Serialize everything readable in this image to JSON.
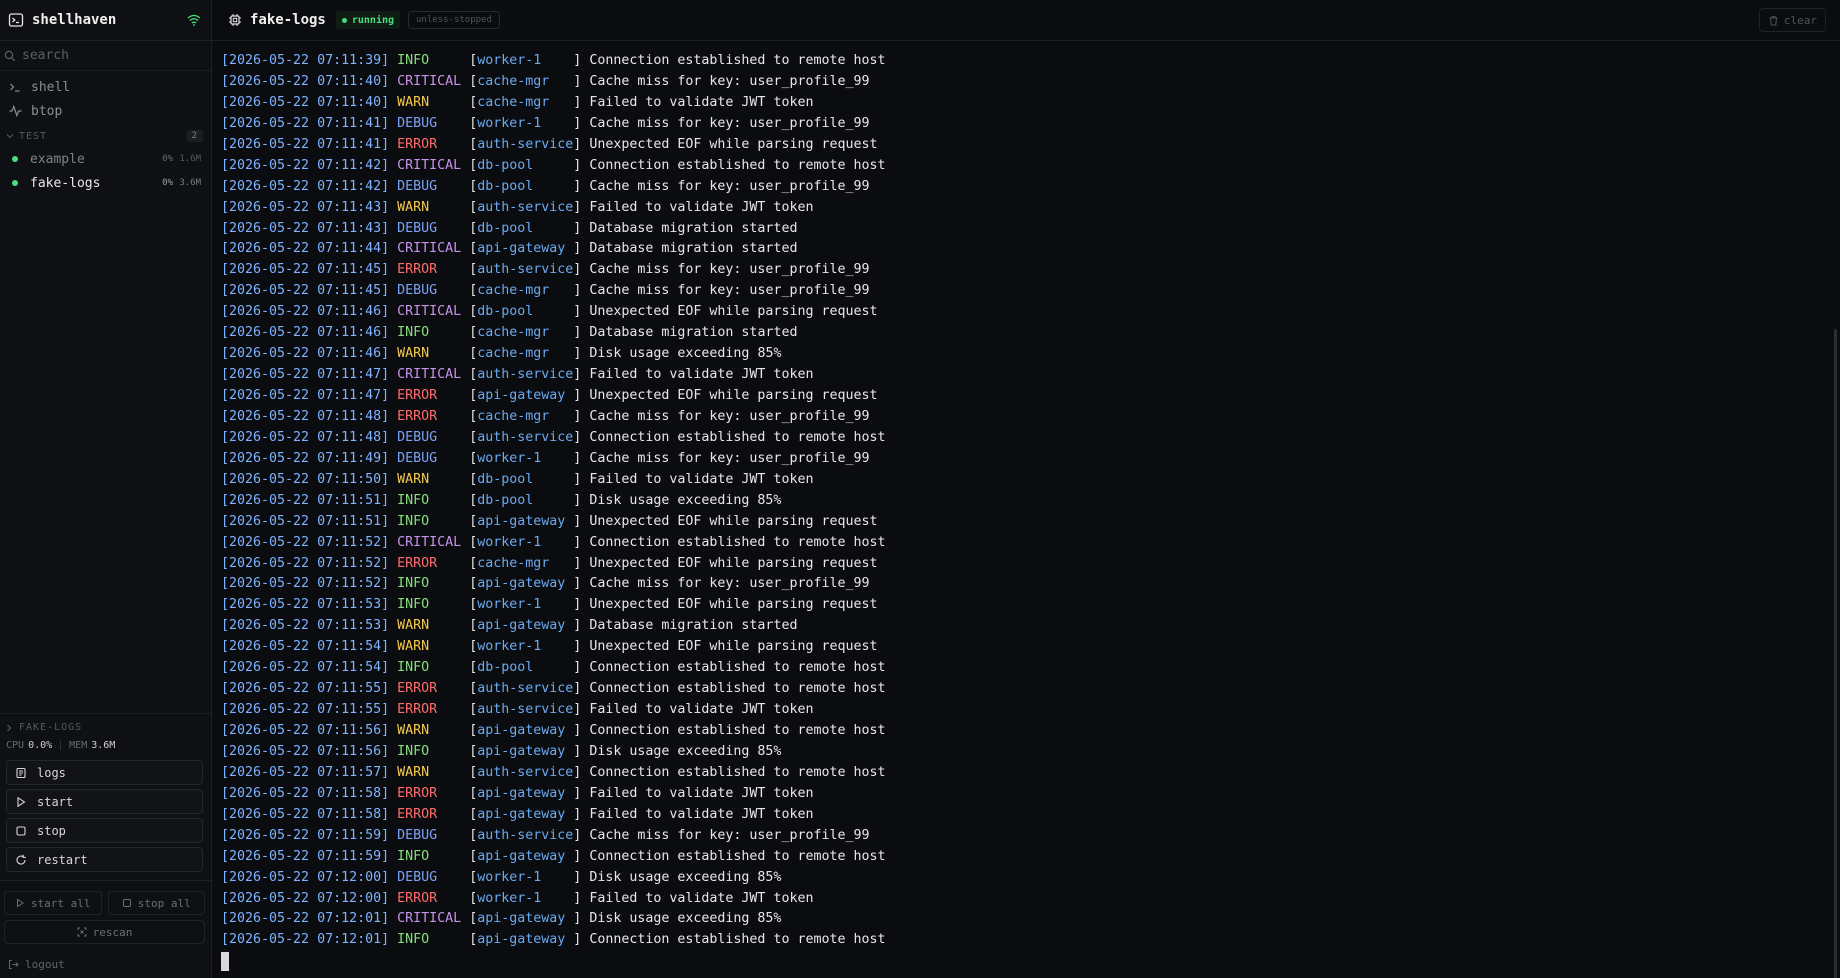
{
  "app": {
    "title": "shellhaven"
  },
  "sidebar": {
    "search_placeholder": "search",
    "nav": [
      {
        "label": "shell",
        "icon": "terminal-prompt-icon"
      },
      {
        "label": "btop",
        "icon": "activity-icon"
      }
    ],
    "group": {
      "label": "TEST",
      "count": "2",
      "services": [
        {
          "name": "example",
          "cpu": "0%",
          "mem": "1.6M",
          "status": "running",
          "active": false
        },
        {
          "name": "fake-logs",
          "cpu": "0%",
          "mem": "3.6M",
          "status": "running",
          "active": true
        }
      ]
    },
    "panel": {
      "title": "FAKE-LOGS",
      "cpu_label": "CPU",
      "cpu_value": "0.0%",
      "mem_label": "MEM",
      "mem_value": "3.6M",
      "actions": [
        {
          "label": "logs",
          "icon": "scroll-icon"
        },
        {
          "label": "start",
          "icon": "play-icon"
        },
        {
          "label": "stop",
          "icon": "stop-icon"
        },
        {
          "label": "restart",
          "icon": "restart-icon"
        }
      ]
    },
    "bulk": {
      "start_all": "start all",
      "stop_all": "stop all",
      "rescan": "rescan"
    },
    "logout": "logout"
  },
  "topbar": {
    "service": "fake-logs",
    "status": "running",
    "policy": "unless-stopped",
    "clear": "clear"
  },
  "colors": {
    "accent_green": "#4ade80",
    "info": "#86e07a",
    "warn": "#f2c94c",
    "error": "#ff6b6b",
    "debug": "#7aa2f7",
    "critical": "#c792ea",
    "timestamp": "#7fb3ff",
    "component": "#6aaaf0"
  },
  "logs": [
    {
      "ts": "[2026-05-22 07:11:39]",
      "level": "INFO",
      "component": "worker-1",
      "message": "Connection established to remote host"
    },
    {
      "ts": "[2026-05-22 07:11:40]",
      "level": "CRITICAL",
      "component": "cache-mgr",
      "message": "Cache miss for key: user_profile_99"
    },
    {
      "ts": "[2026-05-22 07:11:40]",
      "level": "WARN",
      "component": "cache-mgr",
      "message": "Failed to validate JWT token"
    },
    {
      "ts": "[2026-05-22 07:11:41]",
      "level": "DEBUG",
      "component": "worker-1",
      "message": "Cache miss for key: user_profile_99"
    },
    {
      "ts": "[2026-05-22 07:11:41]",
      "level": "ERROR",
      "component": "auth-service",
      "message": "Unexpected EOF while parsing request"
    },
    {
      "ts": "[2026-05-22 07:11:42]",
      "level": "CRITICAL",
      "component": "db-pool",
      "message": "Connection established to remote host"
    },
    {
      "ts": "[2026-05-22 07:11:42]",
      "level": "DEBUG",
      "component": "db-pool",
      "message": "Cache miss for key: user_profile_99"
    },
    {
      "ts": "[2026-05-22 07:11:43]",
      "level": "WARN",
      "component": "auth-service",
      "message": "Failed to validate JWT token"
    },
    {
      "ts": "[2026-05-22 07:11:43]",
      "level": "DEBUG",
      "component": "db-pool",
      "message": "Database migration started"
    },
    {
      "ts": "[2026-05-22 07:11:44]",
      "level": "CRITICAL",
      "component": "api-gateway",
      "message": "Database migration started"
    },
    {
      "ts": "[2026-05-22 07:11:45]",
      "level": "ERROR",
      "component": "auth-service",
      "message": "Cache miss for key: user_profile_99"
    },
    {
      "ts": "[2026-05-22 07:11:45]",
      "level": "DEBUG",
      "component": "cache-mgr",
      "message": "Cache miss for key: user_profile_99"
    },
    {
      "ts": "[2026-05-22 07:11:46]",
      "level": "CRITICAL",
      "component": "db-pool",
      "message": "Unexpected EOF while parsing request"
    },
    {
      "ts": "[2026-05-22 07:11:46]",
      "level": "INFO",
      "component": "cache-mgr",
      "message": "Database migration started"
    },
    {
      "ts": "[2026-05-22 07:11:46]",
      "level": "WARN",
      "component": "cache-mgr",
      "message": "Disk usage exceeding 85%"
    },
    {
      "ts": "[2026-05-22 07:11:47]",
      "level": "CRITICAL",
      "component": "auth-service",
      "message": "Failed to validate JWT token"
    },
    {
      "ts": "[2026-05-22 07:11:47]",
      "level": "ERROR",
      "component": "api-gateway",
      "message": "Unexpected EOF while parsing request"
    },
    {
      "ts": "[2026-05-22 07:11:48]",
      "level": "ERROR",
      "component": "cache-mgr",
      "message": "Cache miss for key: user_profile_99"
    },
    {
      "ts": "[2026-05-22 07:11:48]",
      "level": "DEBUG",
      "component": "auth-service",
      "message": "Connection established to remote host"
    },
    {
      "ts": "[2026-05-22 07:11:49]",
      "level": "DEBUG",
      "component": "worker-1",
      "message": "Cache miss for key: user_profile_99"
    },
    {
      "ts": "[2026-05-22 07:11:50]",
      "level": "WARN",
      "component": "db-pool",
      "message": "Failed to validate JWT token"
    },
    {
      "ts": "[2026-05-22 07:11:51]",
      "level": "INFO",
      "component": "db-pool",
      "message": "Disk usage exceeding 85%"
    },
    {
      "ts": "[2026-05-22 07:11:51]",
      "level": "INFO",
      "component": "api-gateway",
      "message": "Unexpected EOF while parsing request"
    },
    {
      "ts": "[2026-05-22 07:11:52]",
      "level": "CRITICAL",
      "component": "worker-1",
      "message": "Connection established to remote host"
    },
    {
      "ts": "[2026-05-22 07:11:52]",
      "level": "ERROR",
      "component": "cache-mgr",
      "message": "Unexpected EOF while parsing request"
    },
    {
      "ts": "[2026-05-22 07:11:52]",
      "level": "INFO",
      "component": "api-gateway",
      "message": "Cache miss for key: user_profile_99"
    },
    {
      "ts": "[2026-05-22 07:11:53]",
      "level": "INFO",
      "component": "worker-1",
      "message": "Unexpected EOF while parsing request"
    },
    {
      "ts": "[2026-05-22 07:11:53]",
      "level": "WARN",
      "component": "api-gateway",
      "message": "Database migration started"
    },
    {
      "ts": "[2026-05-22 07:11:54]",
      "level": "WARN",
      "component": "worker-1",
      "message": "Unexpected EOF while parsing request"
    },
    {
      "ts": "[2026-05-22 07:11:54]",
      "level": "INFO",
      "component": "db-pool",
      "message": "Connection established to remote host"
    },
    {
      "ts": "[2026-05-22 07:11:55]",
      "level": "ERROR",
      "component": "auth-service",
      "message": "Connection established to remote host"
    },
    {
      "ts": "[2026-05-22 07:11:55]",
      "level": "ERROR",
      "component": "auth-service",
      "message": "Failed to validate JWT token"
    },
    {
      "ts": "[2026-05-22 07:11:56]",
      "level": "WARN",
      "component": "api-gateway",
      "message": "Connection established to remote host"
    },
    {
      "ts": "[2026-05-22 07:11:56]",
      "level": "INFO",
      "component": "api-gateway",
      "message": "Disk usage exceeding 85%"
    },
    {
      "ts": "[2026-05-22 07:11:57]",
      "level": "WARN",
      "component": "auth-service",
      "message": "Connection established to remote host"
    },
    {
      "ts": "[2026-05-22 07:11:58]",
      "level": "ERROR",
      "component": "api-gateway",
      "message": "Failed to validate JWT token"
    },
    {
      "ts": "[2026-05-22 07:11:58]",
      "level": "ERROR",
      "component": "api-gateway",
      "message": "Failed to validate JWT token"
    },
    {
      "ts": "[2026-05-22 07:11:59]",
      "level": "DEBUG",
      "component": "auth-service",
      "message": "Cache miss for key: user_profile_99"
    },
    {
      "ts": "[2026-05-22 07:11:59]",
      "level": "INFO",
      "component": "api-gateway",
      "message": "Connection established to remote host"
    },
    {
      "ts": "[2026-05-22 07:12:00]",
      "level": "DEBUG",
      "component": "worker-1",
      "message": "Disk usage exceeding 85%"
    },
    {
      "ts": "[2026-05-22 07:12:00]",
      "level": "ERROR",
      "component": "worker-1",
      "message": "Failed to validate JWT token"
    },
    {
      "ts": "[2026-05-22 07:12:01]",
      "level": "CRITICAL",
      "component": "api-gateway",
      "message": "Disk usage exceeding 85%"
    },
    {
      "ts": "[2026-05-22 07:12:01]",
      "level": "INFO",
      "component": "api-gateway",
      "message": "Connection established to remote host"
    }
  ]
}
